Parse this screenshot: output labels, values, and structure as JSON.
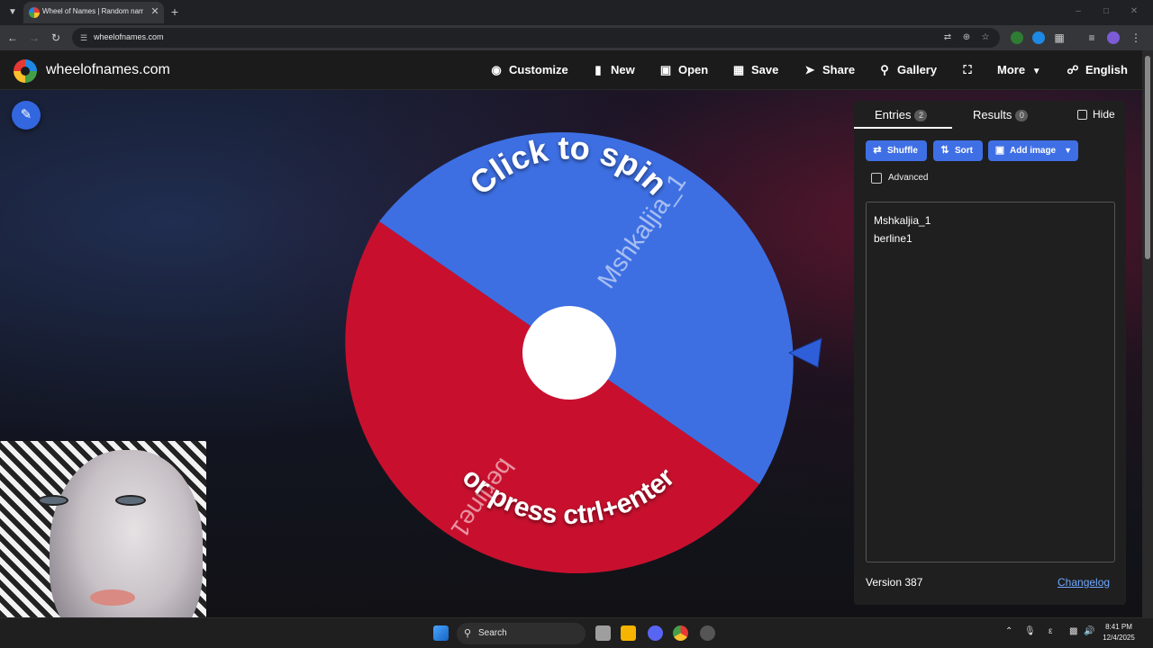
{
  "browser": {
    "tab_title": "Wheel of Names | Random name",
    "url": "wheelofnames.com"
  },
  "site": {
    "title": "wheelofnames.com",
    "nav": [
      {
        "label": "Customize",
        "icon": "palette-icon"
      },
      {
        "label": "New",
        "icon": "file-icon"
      },
      {
        "label": "Open",
        "icon": "folder-open-icon"
      },
      {
        "label": "Save",
        "icon": "floppy-icon"
      },
      {
        "label": "Share",
        "icon": "share-icon"
      },
      {
        "label": "Gallery",
        "icon": "search-icon"
      },
      {
        "label": "",
        "icon": "fullscreen-icon"
      },
      {
        "label": "More",
        "icon": "chevron-down-icon"
      },
      {
        "label": "English",
        "icon": "globe-icon"
      }
    ]
  },
  "wheel": {
    "prompt_top": "Click to spin",
    "prompt_bottom": "or press ctrl+enter",
    "segments": [
      {
        "label": "Mshkaljia_1",
        "color": "#3d6fe3"
      },
      {
        "label": "berline1",
        "color": "#c8102e"
      }
    ],
    "pointer_color": "#2f5fd8"
  },
  "panel": {
    "tabs": [
      {
        "label": "Entries",
        "count": "2"
      },
      {
        "label": "Results",
        "count": "0"
      }
    ],
    "hide_label": "Hide",
    "buttons": {
      "shuffle": "Shuffle",
      "sort": "Sort",
      "add_image": "Add image"
    },
    "advanced_label": "Advanced",
    "entries": [
      "Mshkaljia_1",
      "berline1"
    ],
    "version": "Version 387",
    "changelog": "Changelog"
  },
  "taskbar": {
    "search_label": "Search",
    "clock_time": "8:41 PM",
    "clock_date": "12/4/2025"
  },
  "colors": {
    "accent": "#3f6fe4",
    "wheel_blue": "#3d6fe3",
    "wheel_red": "#c8102e"
  }
}
